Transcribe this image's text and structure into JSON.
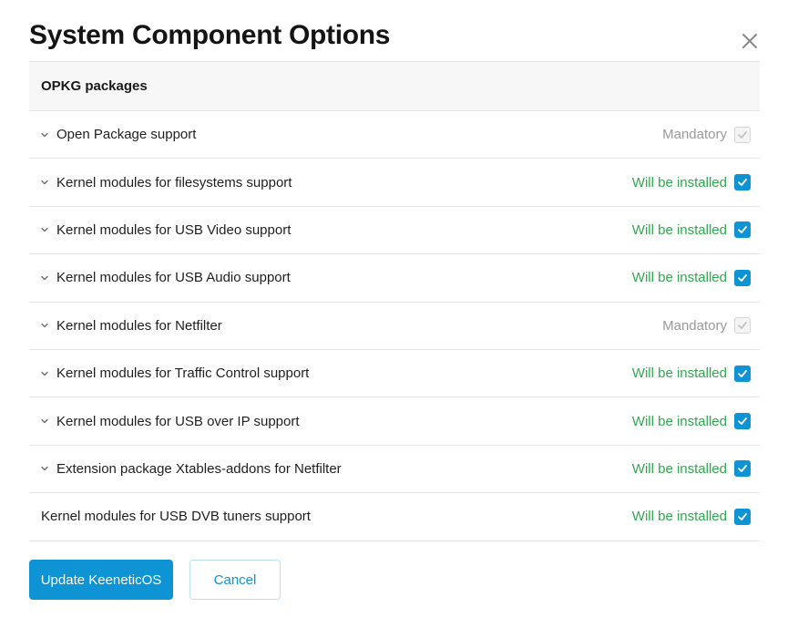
{
  "dialog": {
    "title": "System Component Options",
    "close_icon": "close-icon"
  },
  "section": {
    "header": "OPKG packages",
    "items": [
      {
        "label": "Open Package support",
        "status": "Mandatory",
        "checked": true,
        "locked": true,
        "expandable": true
      },
      {
        "label": "Kernel modules for filesystems support",
        "status": "Will be installed",
        "checked": true,
        "locked": false,
        "expandable": true
      },
      {
        "label": "Kernel modules for USB Video support",
        "status": "Will be installed",
        "checked": true,
        "locked": false,
        "expandable": true
      },
      {
        "label": "Kernel modules for USB Audio support",
        "status": "Will be installed",
        "checked": true,
        "locked": false,
        "expandable": true
      },
      {
        "label": "Kernel modules for Netfilter",
        "status": "Mandatory",
        "checked": true,
        "locked": true,
        "expandable": true
      },
      {
        "label": "Kernel modules for Traffic Control support",
        "status": "Will be installed",
        "checked": true,
        "locked": false,
        "expandable": true
      },
      {
        "label": "Kernel modules for USB over IP support",
        "status": "Will be installed",
        "checked": true,
        "locked": false,
        "expandable": true
      },
      {
        "label": "Extension package Xtables-addons for Netfilter",
        "status": "Will be installed",
        "checked": true,
        "locked": false,
        "expandable": true
      },
      {
        "label": "Kernel modules for USB DVB tuners support",
        "status": "Will be installed",
        "checked": true,
        "locked": false,
        "expandable": false
      }
    ]
  },
  "footer": {
    "primary_label": "Update KeeneticOS",
    "cancel_label": "Cancel"
  },
  "colors": {
    "accent": "#0e93d4",
    "install_status": "#2fa84f",
    "mandatory_status": "#9a9a9a"
  }
}
